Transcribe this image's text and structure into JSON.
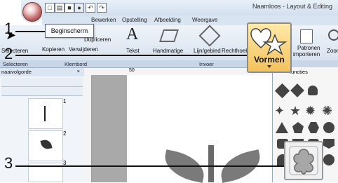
{
  "window": {
    "title": "Naamloos - Layout & Editing"
  },
  "tabs": [
    {
      "label": "Bewerken"
    },
    {
      "label": "Opstelling"
    },
    {
      "label": "Afbeelding"
    },
    {
      "label": "Weergave"
    }
  ],
  "ribbon": {
    "select_label": "Selecteren",
    "copy_label": "Kopieren",
    "delete_label": "Verwijderen",
    "duplicate_label": "Dupliceren",
    "text_label": "Tekst",
    "manual_label": "Handmatige",
    "line_area_label": "Lijn/gebied",
    "rect_label": "Rechthoek/c",
    "patterns_label_1": "Patronen",
    "patterns_label_2": "importeren",
    "zoom_label": "Zoom"
  },
  "groups": {
    "select": "Selecteren",
    "clipboard": "Klembord",
    "insert": "Invoer"
  },
  "tooltip": {
    "text": "Beginscherm"
  },
  "left_panel": {
    "title": "naaivolgorde",
    "thumbnail_numbers": [
      "1",
      "2",
      "3"
    ]
  },
  "ruler": {
    "marks": [
      "50"
    ]
  },
  "shapes_panel": {
    "title": "functies"
  },
  "callouts": {
    "shapes_label": "Vormen",
    "numbers": [
      "1",
      "2",
      "3"
    ]
  },
  "colors": {
    "accent": "#c06a6a",
    "highlight": "#f3c25c"
  }
}
